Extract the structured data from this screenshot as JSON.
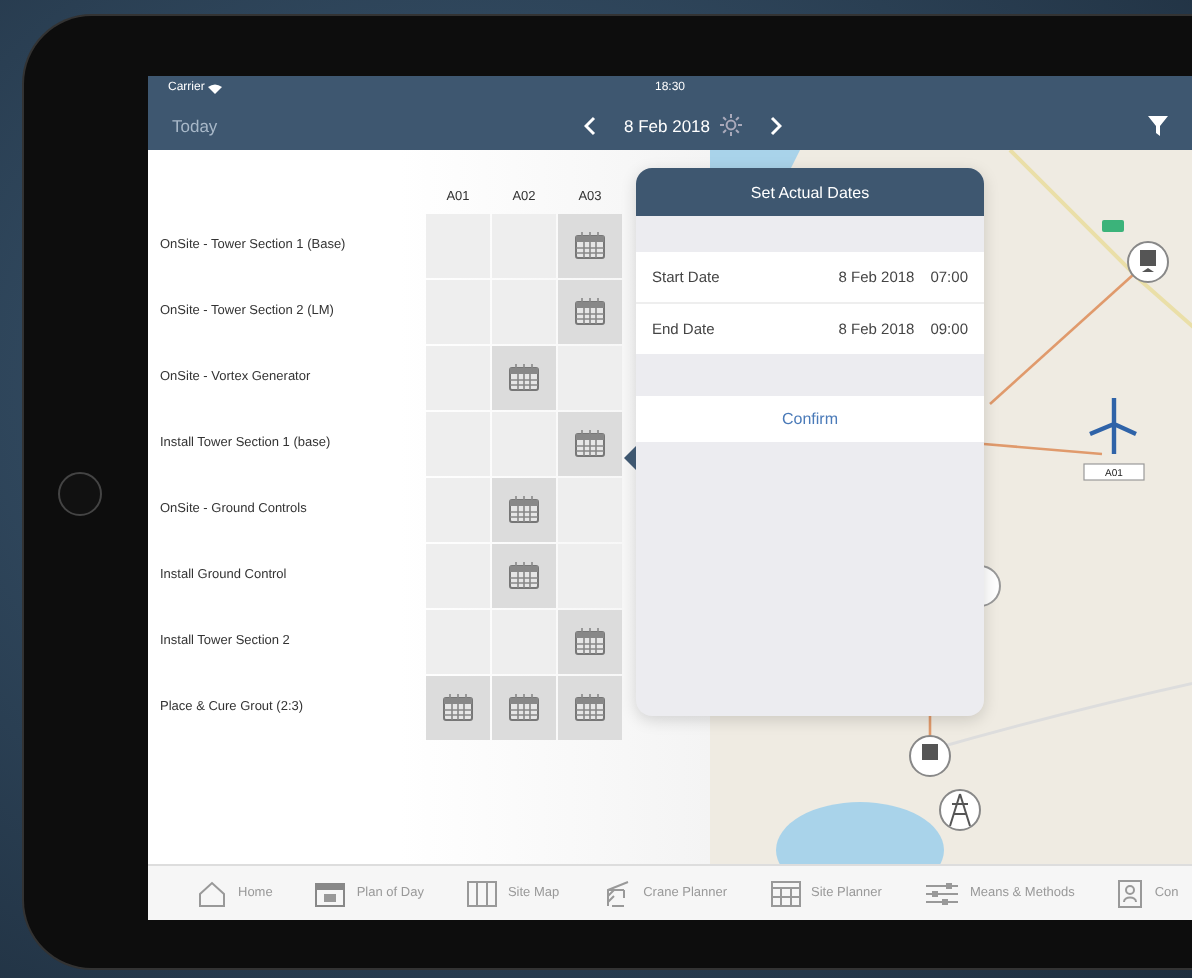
{
  "status_bar": {
    "carrier": "Carrier",
    "time": "18:30"
  },
  "nav_bar": {
    "left": "Today",
    "date": "8 Feb 2018"
  },
  "schedule": {
    "columns": [
      "A01",
      "A02",
      "A03"
    ],
    "rows": [
      {
        "label": "OnSite - Tower Section 1 (Base)",
        "cells": [
          false,
          false,
          true
        ]
      },
      {
        "label": "OnSite - Tower Section 2 (LM)",
        "cells": [
          false,
          false,
          true
        ]
      },
      {
        "label": "OnSite - Vortex Generator",
        "cells": [
          false,
          true,
          false
        ]
      },
      {
        "label": "Install Tower Section 1 (base)",
        "cells": [
          false,
          false,
          true
        ]
      },
      {
        "label": "OnSite - Ground Controls",
        "cells": [
          false,
          true,
          false
        ]
      },
      {
        "label": "Install Ground Control",
        "cells": [
          false,
          true,
          false
        ]
      },
      {
        "label": "Install Tower Section 2",
        "cells": [
          false,
          false,
          true
        ]
      },
      {
        "label": "Place & Cure Grout (2:3)",
        "cells": [
          true,
          true,
          true
        ]
      }
    ]
  },
  "popover": {
    "title": "Set Actual Dates",
    "rows": [
      {
        "label": "Start Date",
        "date": "8 Feb 2018",
        "time": "07:00"
      },
      {
        "label": "End Date",
        "date": "8 Feb 2018",
        "time": "09:00"
      }
    ],
    "confirm": "Confirm"
  },
  "map": {
    "turbine_label": "A01"
  },
  "tab_bar": [
    {
      "label": "Home",
      "kind": "home"
    },
    {
      "label": "Plan of Day",
      "kind": "calendar"
    },
    {
      "label": "Site Map",
      "kind": "map"
    },
    {
      "label": "Crane Planner",
      "kind": "crane"
    },
    {
      "label": "Site Planner",
      "kind": "grid"
    },
    {
      "label": "Means & Methods",
      "kind": "sliders"
    },
    {
      "label": "Con",
      "kind": "person"
    }
  ]
}
